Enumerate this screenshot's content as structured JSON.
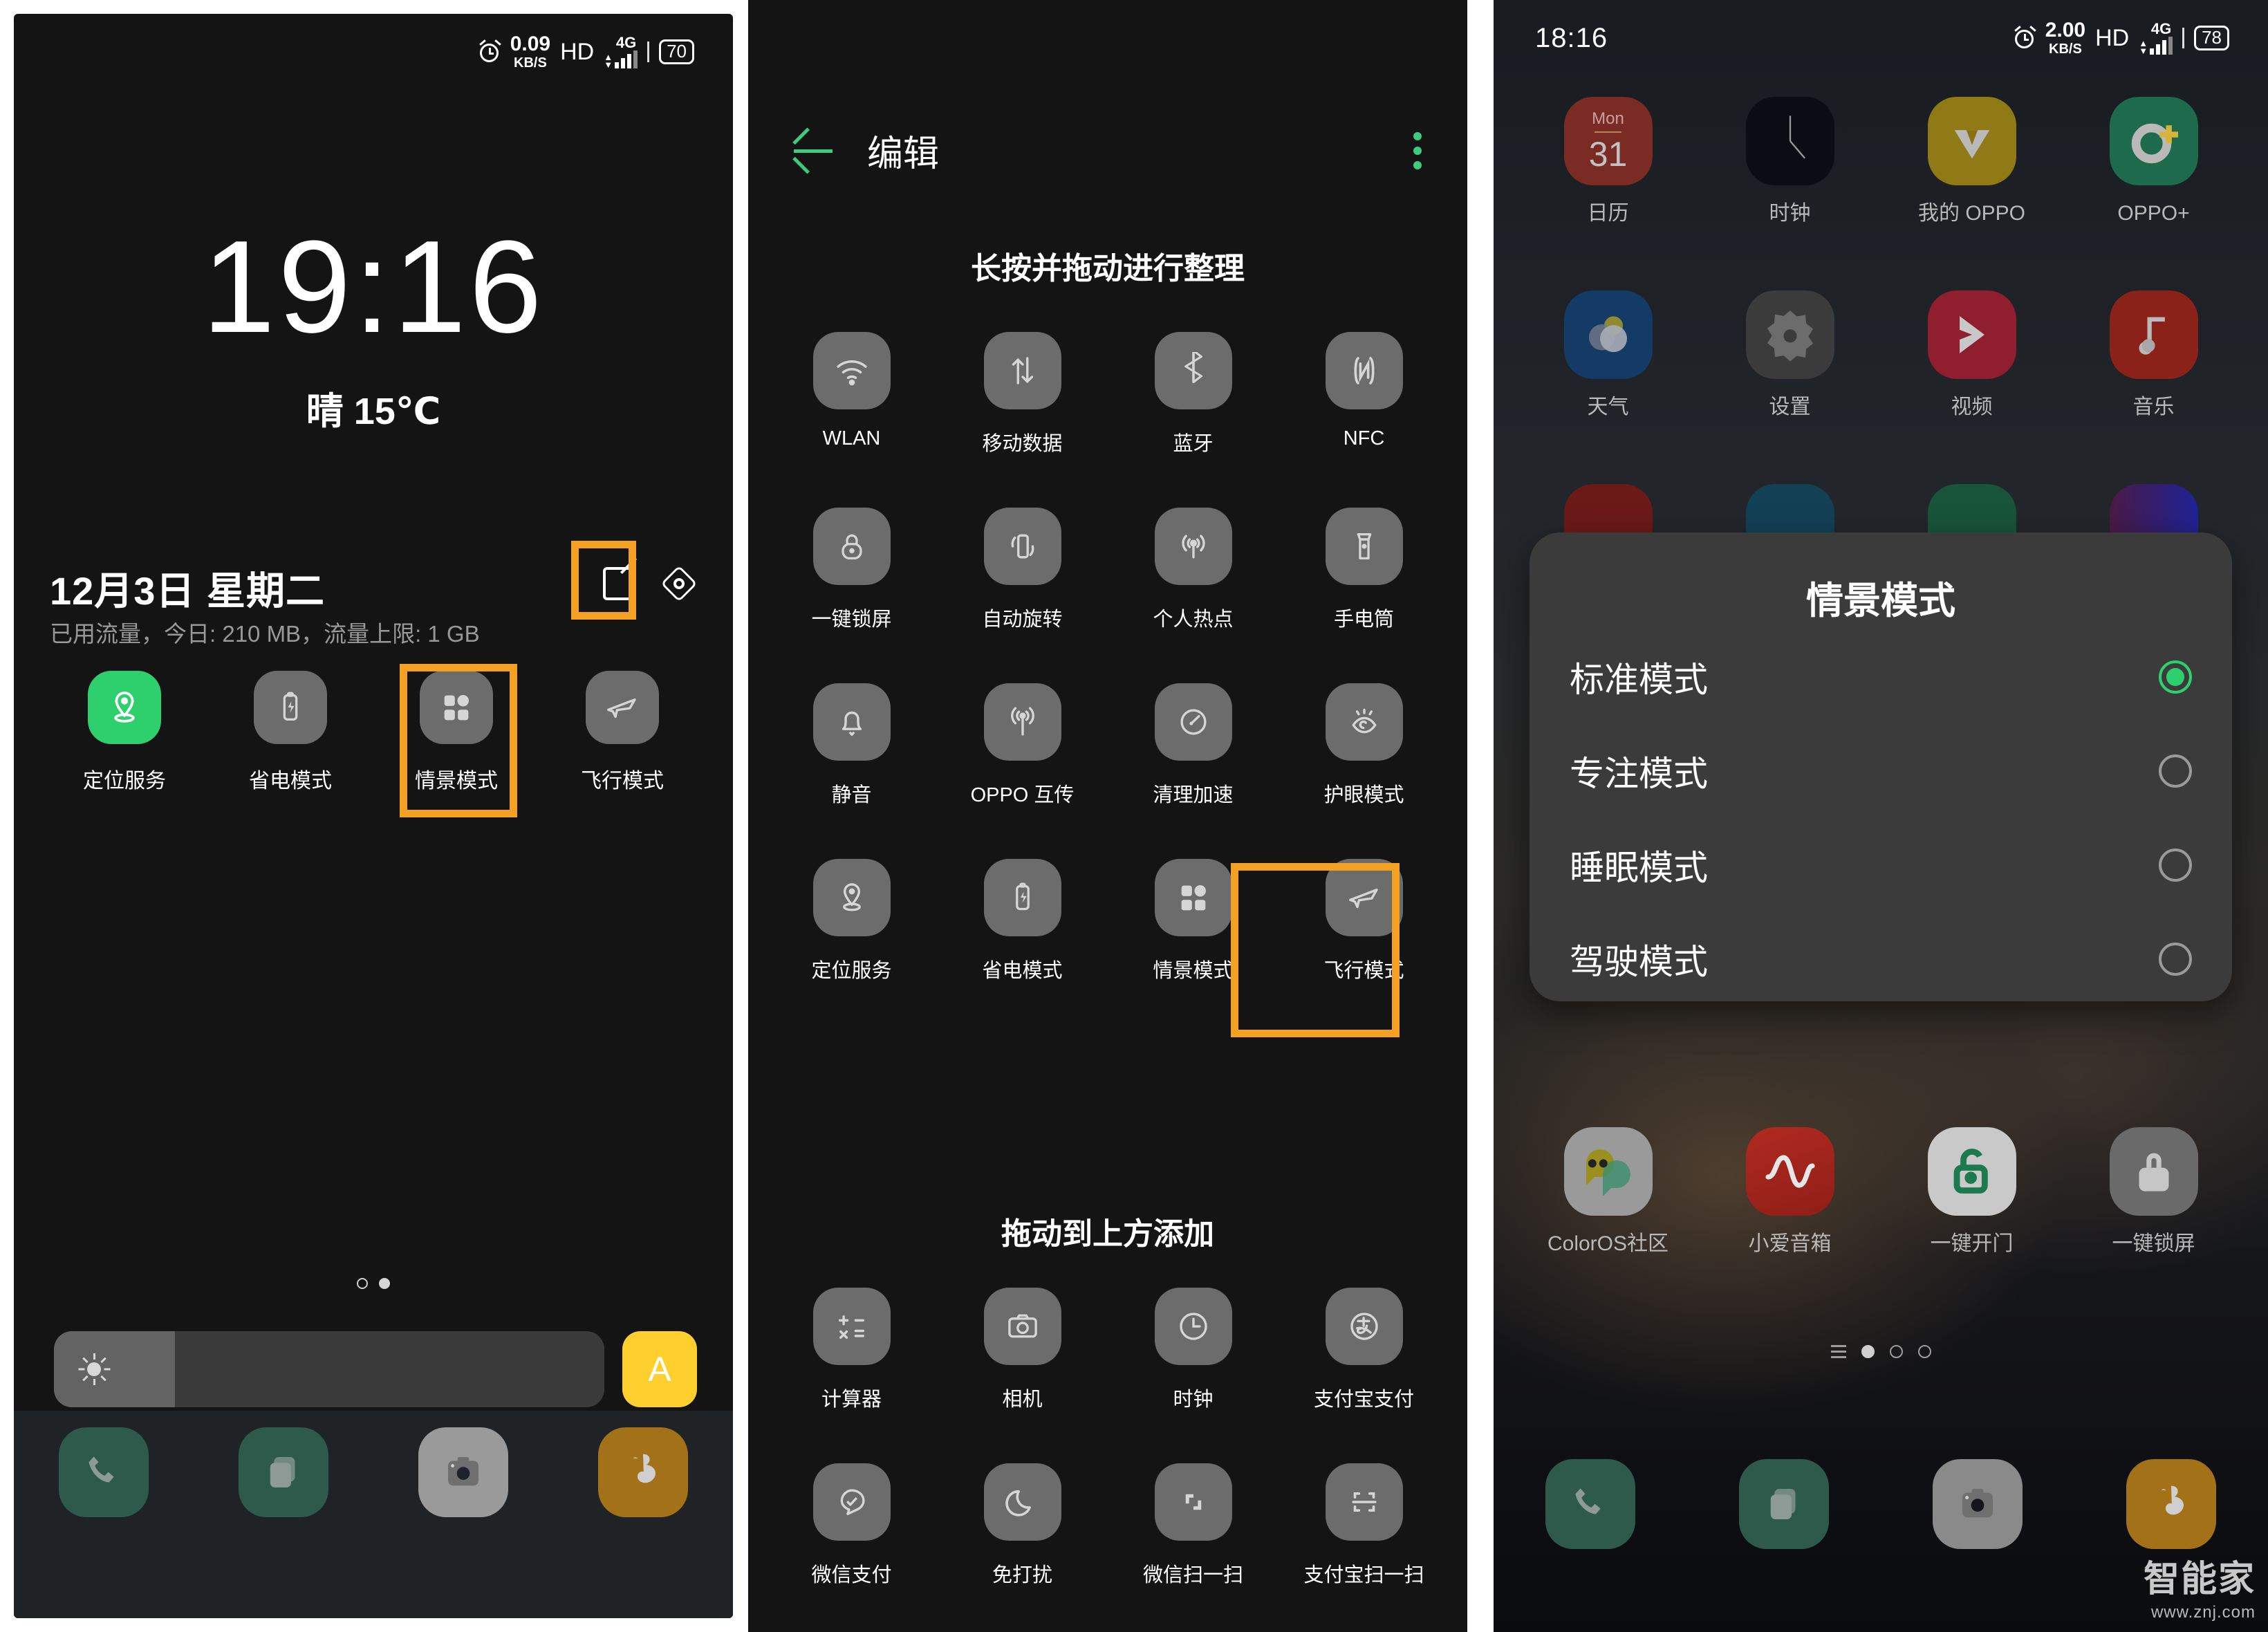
{
  "panel1": {
    "statusbar": {
      "net_value": "0.09",
      "net_unit": "KB/S",
      "hd": "HD",
      "network": "4G",
      "battery": "70"
    },
    "clock": "19:16",
    "weather": "晴 15℃",
    "date": "12月3日  星期二",
    "data_usage": "已用流量，今日: 210 MB，流量上限: 1 GB",
    "toggles": [
      {
        "label": "定位服务",
        "icon": "location-icon",
        "active": true
      },
      {
        "label": "省电模式",
        "icon": "battery-saver-icon",
        "active": false
      },
      {
        "label": "情景模式",
        "icon": "scene-mode-icon",
        "active": false,
        "highlighted": true
      },
      {
        "label": "飞行模式",
        "icon": "airplane-icon",
        "active": false
      }
    ],
    "pager": {
      "pages": 2,
      "active": 2
    },
    "brightness": {
      "level_percent": 15,
      "auto_label": "A",
      "icon": "brightness-icon"
    },
    "cast_icon": "screencast-icon",
    "dock": [
      {
        "name": "phone-app",
        "color": "#2e5a4b"
      },
      {
        "name": "messages-app",
        "color": "#2e5a4b"
      },
      {
        "name": "camera-app",
        "color": "#9a9a9a"
      },
      {
        "name": "uc-browser-app",
        "color": "#a37218"
      }
    ]
  },
  "panel2": {
    "back_icon": "back-arrow-icon",
    "title": "编辑",
    "more_icon": "more-vertical-icon",
    "section_top": "长按并拖动进行整理",
    "section_bottom": "拖动到上方添加",
    "active_tiles": [
      {
        "label": "WLAN",
        "icon": "wifi-icon"
      },
      {
        "label": "移动数据",
        "icon": "mobile-data-icon"
      },
      {
        "label": "蓝牙",
        "icon": "bluetooth-icon"
      },
      {
        "label": "NFC",
        "icon": "nfc-icon"
      },
      {
        "label": "一键锁屏",
        "icon": "lock-icon"
      },
      {
        "label": "自动旋转",
        "icon": "auto-rotate-icon"
      },
      {
        "label": "个人热点",
        "icon": "hotspot-icon"
      },
      {
        "label": "手电筒",
        "icon": "flashlight-icon"
      },
      {
        "label": "静音",
        "icon": "mute-bell-icon"
      },
      {
        "label": "OPPO 互传",
        "icon": "oppo-share-icon"
      },
      {
        "label": "清理加速",
        "icon": "speed-clean-icon"
      },
      {
        "label": "护眼模式",
        "icon": "eye-care-icon"
      },
      {
        "label": "定位服务",
        "icon": "location-icon"
      },
      {
        "label": "省电模式",
        "icon": "battery-saver-icon"
      },
      {
        "label": "情景模式",
        "icon": "scene-mode-icon",
        "highlighted": true
      },
      {
        "label": "飞行模式",
        "icon": "airplane-icon"
      }
    ],
    "available_tiles": [
      {
        "label": "计算器",
        "icon": "calculator-icon"
      },
      {
        "label": "相机",
        "icon": "camera-icon"
      },
      {
        "label": "时钟",
        "icon": "clock-icon"
      },
      {
        "label": "支付宝支付",
        "icon": "alipay-pay-icon"
      },
      {
        "label": "微信支付",
        "icon": "wechat-pay-icon"
      },
      {
        "label": "免打扰",
        "icon": "moon-dnd-icon"
      },
      {
        "label": "微信扫一扫",
        "icon": "wechat-scan-icon"
      },
      {
        "label": "支付宝扫一扫",
        "icon": "alipay-scan-icon"
      }
    ]
  },
  "panel3": {
    "statusbar": {
      "clock": "18:16",
      "net_value": "2.00",
      "net_unit": "KB/S",
      "hd": "HD",
      "network": "4G",
      "battery": "78"
    },
    "apps_row1": [
      {
        "label": "日历",
        "icon": "calendar-app",
        "color": "#7a2b23",
        "badge_day": "Mon",
        "badge_date": "31"
      },
      {
        "label": "时钟",
        "icon": "clock-app",
        "color": "#0a0d14"
      },
      {
        "label": "我的 OPPO",
        "icon": "my-oppo-app",
        "color": "#8f7a16"
      },
      {
        "label": "OPPO+",
        "icon": "oppo-plus-app",
        "color": "#1d6b4c"
      }
    ],
    "apps_row2": [
      {
        "label": "天气",
        "icon": "weather-app",
        "color": "#143a66"
      },
      {
        "label": "设置",
        "icon": "settings-app",
        "color": "#3b3b3b"
      },
      {
        "label": "视频",
        "icon": "video-app",
        "color": "#8f1f2e"
      },
      {
        "label": "音乐",
        "icon": "music-app",
        "color": "#8b2219"
      }
    ],
    "apps_row4": [
      {
        "label": "ColorOS社区",
        "icon": "coloros-community-app",
        "color": "#9a9a9a"
      },
      {
        "label": "小爱音箱",
        "icon": "xiaoai-speaker-app",
        "color": "#b02a20"
      },
      {
        "label": "一键开门",
        "icon": "one-tap-door-app",
        "color": "#c9c9c9"
      },
      {
        "label": "一键锁屏",
        "icon": "one-tap-lock-app",
        "color": "#6a6a6a"
      }
    ],
    "dialog": {
      "title": "情景模式",
      "options": [
        {
          "label": "标准模式",
          "selected": true
        },
        {
          "label": "专注模式",
          "selected": false
        },
        {
          "label": "睡眠模式",
          "selected": false
        },
        {
          "label": "驾驶模式",
          "selected": false
        }
      ]
    },
    "pager": {
      "pages": 3,
      "active": 1
    },
    "dock": [
      {
        "name": "phone-app",
        "color": "#2e5a4b"
      },
      {
        "name": "messages-app",
        "color": "#2e5a4b"
      },
      {
        "name": "camera-app",
        "color": "#8a8a8a"
      },
      {
        "name": "uc-browser-app",
        "color": "#a37218"
      }
    ]
  },
  "watermark": {
    "brand": "智能家",
    "url": "www.znj.com"
  },
  "colors": {
    "accent_green": "#2ed06e",
    "highlight_orange": "#f4a023",
    "auto_yellow": "#ffcf2e"
  }
}
